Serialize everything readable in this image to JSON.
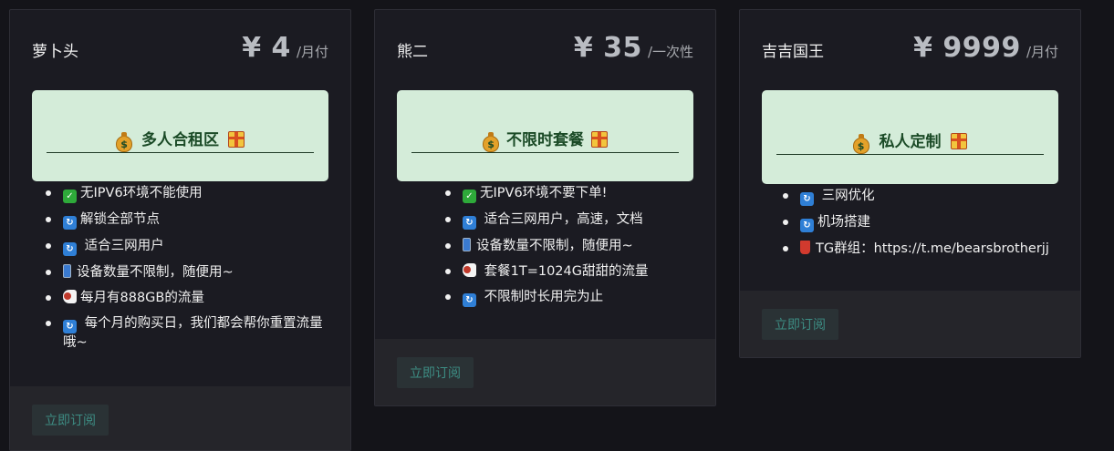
{
  "plans": [
    {
      "name": "萝卜头",
      "price": "¥ 4",
      "period": "/月付",
      "banner": "多人合租区",
      "features": [
        {
          "icon": "check-icon",
          "text": "无IPV6环境不能使用"
        },
        {
          "icon": "refresh-icon",
          "text": "解锁全部节点"
        },
        {
          "icon": "refresh-icon",
          "text": " 适合三网用户"
        },
        {
          "icon": "phone-icon",
          "text": "设备数量不限制，随便用~"
        },
        {
          "icon": "meat-icon",
          "text": "每月有888GB的流量"
        },
        {
          "icon": "refresh-icon",
          "text": " 每个月的购买日，我们都会帮你重置流量哦~"
        }
      ],
      "subscribe_label": "立即订阅"
    },
    {
      "name": "熊二",
      "price": "¥ 35",
      "period": "/一次性",
      "banner": "不限时套餐",
      "features": [
        {
          "icon": "check-icon",
          "text": "无IPV6环境不要下单!"
        },
        {
          "icon": "refresh-icon",
          "text": " 适合三网用户，高速，文档"
        },
        {
          "icon": "phone-icon",
          "text": "设备数量不限制，随便用~"
        },
        {
          "icon": "meat-icon",
          "text": " 套餐1T=1024G甜甜的流量"
        },
        {
          "icon": "refresh-icon",
          "text": " 不限制时长用完为止"
        }
      ],
      "subscribe_label": "立即订阅"
    },
    {
      "name": "吉吉国王",
      "price": "¥ 9999",
      "period": "/月付",
      "banner": "私人定制",
      "features": [
        {
          "icon": "refresh-icon",
          "text": " 三网优化"
        },
        {
          "icon": "refresh-icon",
          "text": "机场搭建"
        },
        {
          "icon": "cup-icon",
          "text": "TG群组：https://t.me/bearsbrotherjj"
        }
      ],
      "subscribe_label": "立即订阅"
    }
  ],
  "colors": {
    "page_bg": "#141419",
    "card_bg": "#1b1b22",
    "banner_bg": "#d4ecd9",
    "banner_text": "#1a4a26",
    "button_text": "#3d8d84"
  }
}
